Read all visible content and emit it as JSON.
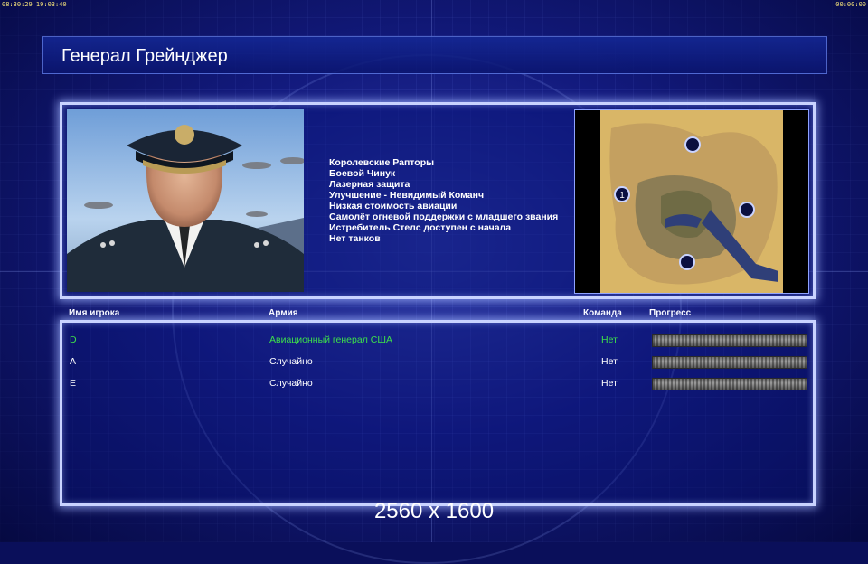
{
  "system_bar": {
    "left": "08:30:29 19:03:40",
    "right": "00:00:00"
  },
  "title": "Генерал Грейнджер",
  "features": [
    "Королевские Рапторы",
    "Боевой Чинук",
    "Лазерная защита",
    "Улучшение - Невидимый Команч",
    "Низкая стоимость авиации",
    "Самолёт огневой поддержки с младшего звания",
    "Истребитель Стелс доступен с начала",
    "Нет танков"
  ],
  "minimap": {
    "start_position_label": "1"
  },
  "columns": {
    "player": "Имя игрока",
    "army": "Армия",
    "team": "Команда",
    "progress": "Прогресс"
  },
  "players": [
    {
      "name": "D",
      "army": "Авиационный генерал США",
      "team": "Нет",
      "highlight": true
    },
    {
      "name": "A",
      "army": "Случайно",
      "team": "Нет",
      "highlight": false
    },
    {
      "name": "E",
      "army": "Случайно",
      "team": "Нет",
      "highlight": false
    }
  ],
  "resolution": "2560 x 1600",
  "colors": {
    "highlight_text": "#3de04a",
    "panel_border": "#c9d3ff",
    "background": "#0c1270"
  }
}
